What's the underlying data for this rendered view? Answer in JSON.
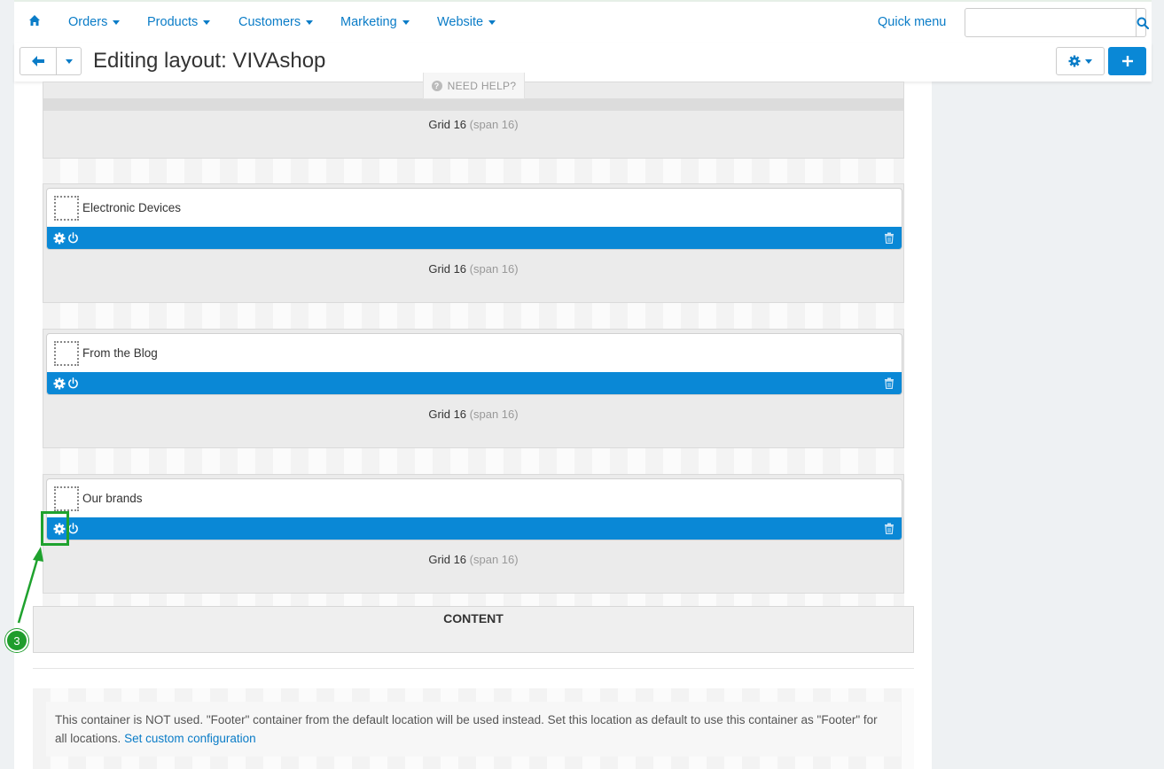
{
  "nav": {
    "home_icon": "home-icon",
    "items": [
      {
        "label": "Orders"
      },
      {
        "label": "Products"
      },
      {
        "label": "Customers"
      },
      {
        "label": "Marketing"
      },
      {
        "label": "Website"
      }
    ],
    "quick_menu": "Quick menu",
    "search_placeholder": ""
  },
  "titlebar": {
    "title": "Editing layout: VIVAshop",
    "need_help": "NEED HELP?"
  },
  "grids": [
    {
      "label": "Grid 16",
      "span": "(span 16)"
    },
    {
      "label": "Grid 16",
      "span": "(span 16)",
      "block": "Electronic Devices"
    },
    {
      "label": "Grid 16",
      "span": "(span 16)",
      "block": "From the Blog"
    },
    {
      "label": "Grid 16",
      "span": "(span 16)",
      "block": "Our brands"
    }
  ],
  "content_label": "CONTENT",
  "footer": {
    "note": "This container is NOT used. \"Footer\" container from the default location will be used instead. Set this location as default to use this container as \"Footer\" for all locations.",
    "link": "Set custom configuration"
  },
  "annotation": {
    "number": "3"
  },
  "colors": {
    "accent": "#0a88d6",
    "link": "#0a7cc7",
    "annotation": "#1f9d2c"
  }
}
